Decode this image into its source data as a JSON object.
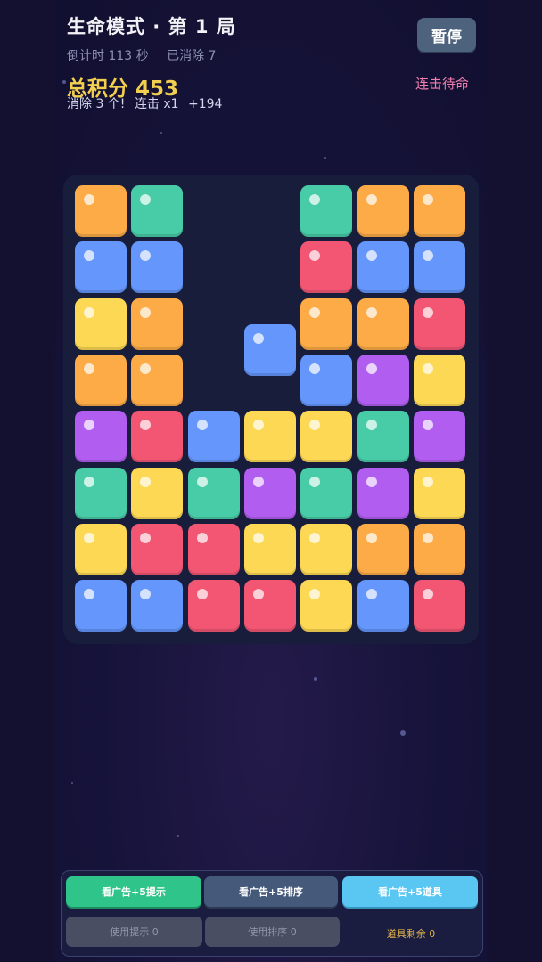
{
  "header": {
    "title": "生命模式 · 第 1 局",
    "countdown": "倒计时 113 秒",
    "cleared": "已消除 7"
  },
  "score": {
    "label": "总积分",
    "value": "453"
  },
  "last_clear": {
    "message": "消除 3 个!",
    "combo": "连击 x1",
    "gain": "+194"
  },
  "pause_label": "暂停",
  "combo_status": "连击待命",
  "board": {
    "columns": 7,
    "rows": 8,
    "grid": [
      [
        "orange",
        "teal",
        null,
        null,
        "teal",
        "orange",
        "orange"
      ],
      [
        "blue",
        "blue",
        null,
        null,
        "red",
        "blue",
        "blue"
      ],
      [
        "yellow",
        "orange",
        null,
        null,
        "orange",
        "orange",
        "red"
      ],
      [
        "orange",
        "orange",
        null,
        null,
        "blue",
        "purple",
        "yellow"
      ],
      [
        "purple",
        "red",
        "blue",
        "yellow",
        "yellow",
        "teal",
        "purple"
      ],
      [
        "teal",
        "yellow",
        "teal",
        "purple",
        "teal",
        "purple",
        "yellow"
      ],
      [
        "yellow",
        "red",
        "red",
        "yellow",
        "yellow",
        "orange",
        "orange"
      ],
      [
        "blue",
        "blue",
        "red",
        "red",
        "yellow",
        "blue",
        "red"
      ]
    ],
    "falling_block": {
      "color": "blue",
      "column": 3
    }
  },
  "colors": {
    "orange": "#fcab46",
    "teal": "#48cba7",
    "blue": "#6496fc",
    "yellow": "#fcd854",
    "red": "#f25673",
    "purple": "#b05df0",
    "score_gold": "#f2cf4e",
    "combo_pink": "#f27fb0"
  },
  "actions": {
    "ad_hint": "看广告+5提示",
    "ad_sort": "看广告+5排序",
    "ad_item": "看广告+5道具",
    "use_hint": "使用提示 0",
    "use_sort": "使用排序 0",
    "items_left": "道具剩余 0"
  }
}
